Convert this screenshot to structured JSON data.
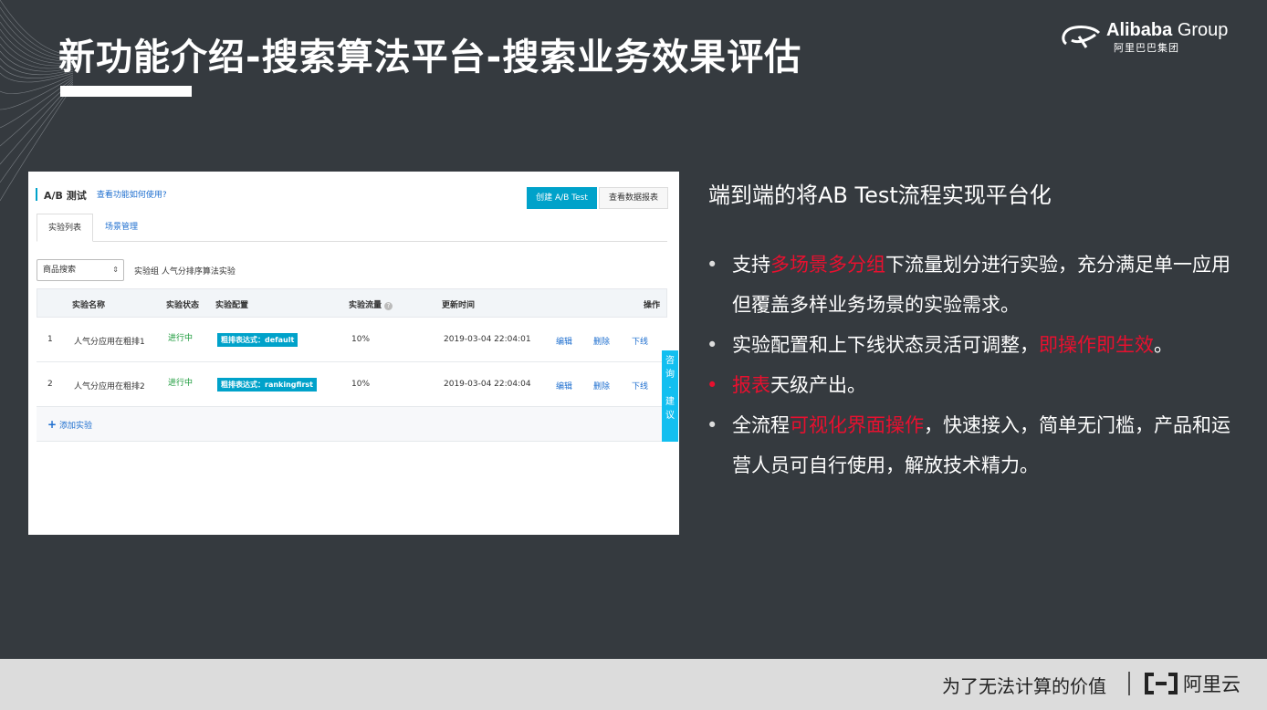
{
  "slide": {
    "title": "新功能介绍-搜索算法平台-搜索业务效果评估",
    "brand": {
      "name_bold": "Alibaba",
      "name_light": "Group",
      "sub": "阿里巴巴集团"
    }
  },
  "screenshot": {
    "header_title": "A/B 测试",
    "help_link": "查看功能如何使用?",
    "create_button": "创建 A/B Test",
    "report_button": "查看数据报表",
    "tabs": [
      "实验列表",
      "场景管理"
    ],
    "select_value": "商品搜索",
    "select_arrow": "⇕",
    "group_label": "实验组 人气分排序算法实验",
    "table": {
      "headers": [
        "实验名称",
        "实验状态",
        "实验配置",
        "实验流量",
        "更新时间",
        "操作"
      ],
      "info_icon": "?",
      "rows": [
        {
          "idx": "1",
          "name": "人气分应用在粗排1",
          "status": "进行中",
          "config": "粗排表达式：default",
          "traffic": "10%",
          "updated": "2019-03-04 22:04:01",
          "ops": [
            "编辑",
            "删除",
            "下线"
          ]
        },
        {
          "idx": "2",
          "name": "人气分应用在粗排2",
          "status": "进行中",
          "config": "粗排表达式：rankingfirst",
          "traffic": "10%",
          "updated": "2019-03-04 22:04:04",
          "ops": [
            "编辑",
            "删除",
            "下线"
          ]
        }
      ],
      "add_plus": "+",
      "add_label": "添加实验"
    },
    "consult": [
      "咨",
      "询",
      "·",
      "建",
      "议"
    ]
  },
  "right": {
    "subhead": "端到端的将AB Test流程实现平台化",
    "bullet_mark": "•",
    "bullets": [
      {
        "pre": "支持",
        "hl": "多场景多分组",
        "post": "下流量划分进行实验，充分满足单一应用但覆盖多样业务场景的实验需求。"
      },
      {
        "pre": "实验配置和上下线状态灵活可调整，",
        "hl": "即操作即生效",
        "post": "。"
      },
      {
        "pre": "",
        "hl": "报表",
        "post": "天级产出。"
      },
      {
        "pre": "全流程",
        "hl": "可视化界面操作",
        "post": "，快速接入，简单无门槛，产品和运营人员可自行使用，解放技术精力。"
      }
    ]
  },
  "footer": {
    "slogan": "为了无法计算的价值",
    "aliyun": "阿里云"
  },
  "colors": {
    "background": "#353a3f",
    "accent": "#00a2ca",
    "highlight": "#e8102f",
    "status_green": "#1a9a3a"
  }
}
